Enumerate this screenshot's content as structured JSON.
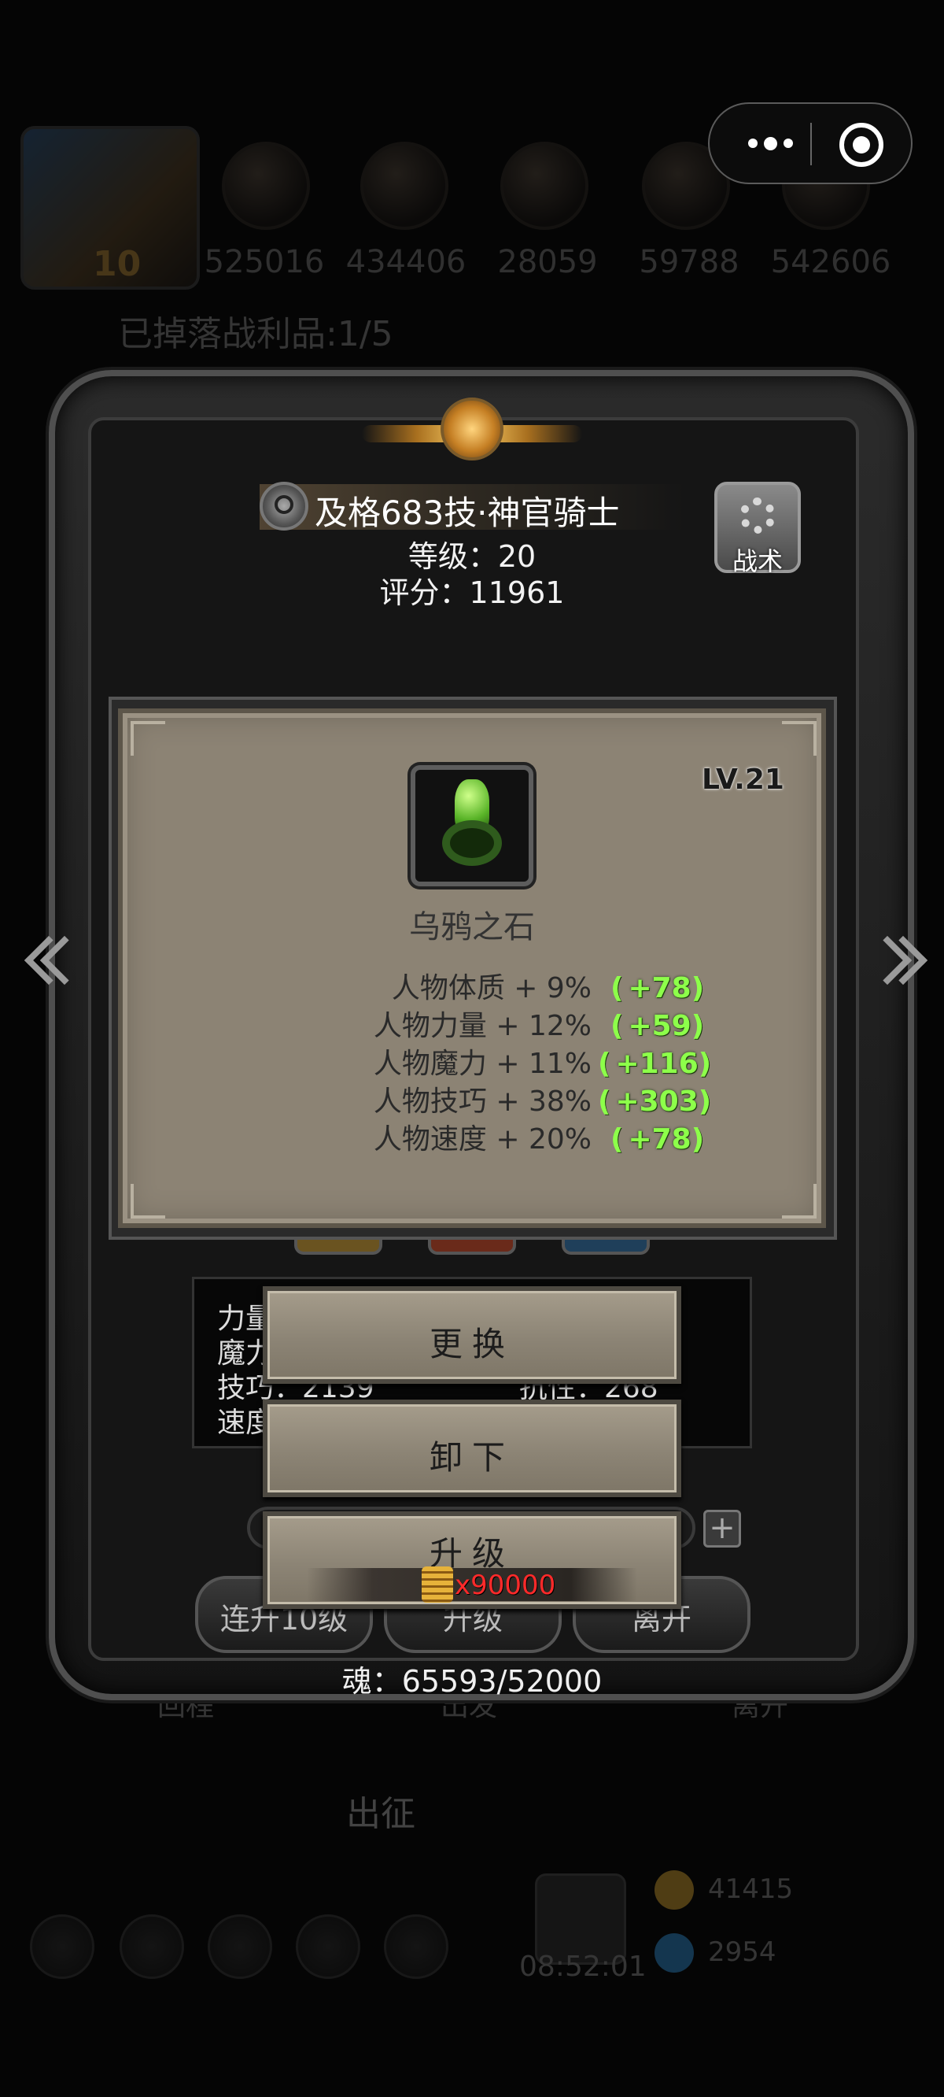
{
  "background": {
    "resources": [
      "525016",
      "434406",
      "28059",
      "59788",
      "542606"
    ],
    "hero_level_badge": "10",
    "loot_text": "已掉落战利品:1/5",
    "bottom_tabs": [
      "回程",
      "出发",
      "离开"
    ],
    "expedition_label": "出征",
    "timer": "08:52:01",
    "gold": "41415",
    "gems": "2954"
  },
  "hero": {
    "name": "及格683技·神官骑士",
    "level": "等级：20",
    "score": "评分：11961",
    "tactics_label": "战术"
  },
  "equipment": {
    "level": "LV.21",
    "name": "乌鸦之石",
    "stats": [
      {
        "label": "人物体质 + 9%",
        "bonus": "+78"
      },
      {
        "label": "人物力量 + 12%",
        "bonus": "+59"
      },
      {
        "label": "人物魔力 + 11%",
        "bonus": "+116"
      },
      {
        "label": "人物技巧 + 38%",
        "bonus": "+303"
      },
      {
        "label": "人物速度 + 20%",
        "bonus": "+78"
      }
    ]
  },
  "partial_stats": [
    "力量",
    "魔力",
    "技巧：2139",
    "速度"
  ],
  "partial_stats_right": "抗性：268",
  "actions": {
    "replace": "更换",
    "unequip": "卸下",
    "upgrade": "升级",
    "upgrade_cost": "x90000"
  },
  "bottom_buttons": [
    "连升10级",
    "升级",
    "离开"
  ],
  "soul": "魂：65593/52000"
}
